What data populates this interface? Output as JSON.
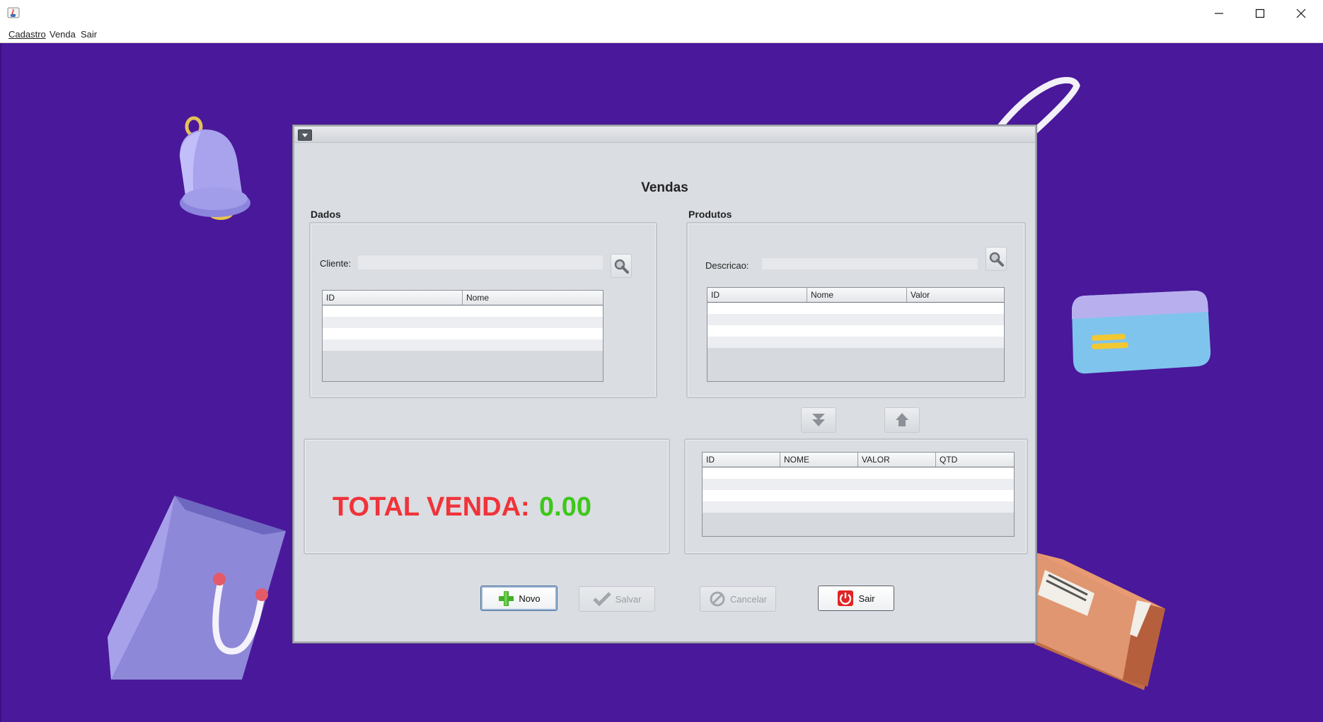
{
  "window": {
    "icon": "java-coffee-icon",
    "controls": {
      "minimize": "minimize-icon",
      "maximize": "maximize-icon",
      "close": "close-icon"
    }
  },
  "menubar": {
    "items": [
      {
        "label": "Cadastro",
        "mnemonic": "C"
      },
      {
        "label": "Venda",
        "mnemonic": ""
      },
      {
        "label": "Sair",
        "mnemonic": "S"
      }
    ]
  },
  "desktop": {
    "background": "#4a189a"
  },
  "vendas": {
    "title": "Vendas",
    "dados": {
      "title": "Dados",
      "cliente_label": "Cliente:",
      "cliente_value": "",
      "table": {
        "columns": [
          "ID",
          "Nome"
        ],
        "rows": []
      }
    },
    "produtos": {
      "title": "Produtos",
      "descricao_label": "Descricao:",
      "descricao_value": "",
      "table": {
        "columns": [
          "ID",
          "Nome",
          "Valor"
        ],
        "rows": []
      }
    },
    "move_buttons": {
      "add": "arrow-down-icon",
      "remove": "arrow-up-icon"
    },
    "total": {
      "label": "TOTAL VENDA:",
      "value": "0.00",
      "label_color": "#f0333a",
      "value_color": "#3ec71c"
    },
    "itens_table": {
      "columns": [
        "ID",
        "NOME",
        "VALOR",
        "QTD"
      ],
      "rows": []
    },
    "buttons": {
      "novo": {
        "label": "Novo",
        "enabled": true
      },
      "salvar": {
        "label": "Salvar",
        "enabled": false
      },
      "cancelar": {
        "label": "Cancelar",
        "enabled": false
      },
      "sair": {
        "label": "Sair",
        "enabled": true
      }
    }
  }
}
